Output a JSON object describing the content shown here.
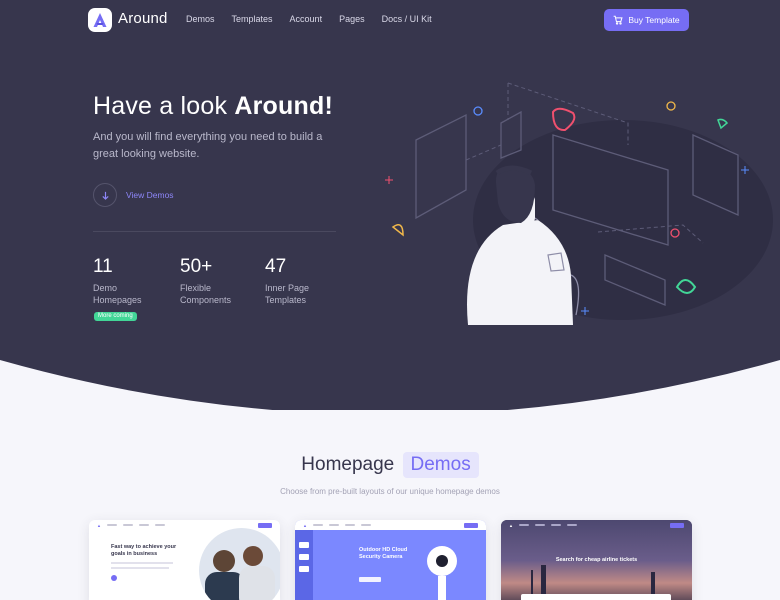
{
  "brand": {
    "name": "Around",
    "accent": "#766df4",
    "hero_bg": "#37364d"
  },
  "nav": {
    "links": [
      "Demos",
      "Templates",
      "Account",
      "Pages",
      "Docs / UI Kit"
    ],
    "buy_label": "Buy Template",
    "buy_icon": "cart-icon"
  },
  "hero": {
    "title_light": "Have a look ",
    "title_bold": "Around!",
    "subtitle": "And you will find everything you need to build a great looking website.",
    "cta_label": "View Demos",
    "stats": [
      {
        "value": "11",
        "label": "Demo Homepages"
      },
      {
        "value": "50+",
        "label": "Flexible Components"
      },
      {
        "value": "47",
        "label": "Inner Page Templates"
      }
    ],
    "badge": "More coming"
  },
  "homepage": {
    "title": "Homepage",
    "title_highlight": "Demos",
    "subtitle": "Choose from pre-built layouts of our unique homepage demos"
  },
  "demos": [
    {
      "heading": "Fast way to achieve your goals in business"
    },
    {
      "heading": "Outdoor HD Cloud Security Camera"
    },
    {
      "heading": "Search for cheap airline tickets"
    }
  ]
}
